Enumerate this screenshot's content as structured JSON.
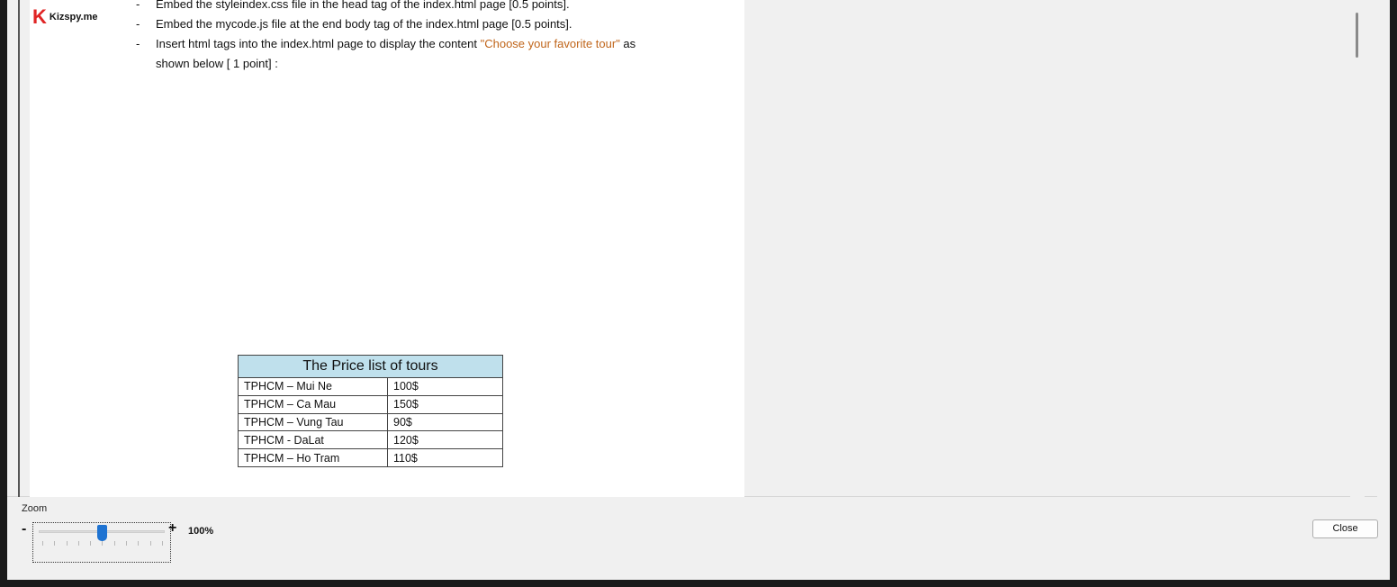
{
  "logo": {
    "mark": "K",
    "text": "Kizspy.me"
  },
  "document": {
    "bullets": [
      {
        "marker": "-",
        "text": "Embed the styleindex.css file in the head tag of the index.html page [0.5 points]."
      },
      {
        "marker": "-",
        "text": "Embed the mycode.js file at the end body tag of the index.html page [0.5 points]."
      },
      {
        "marker": "-",
        "text_before": "Insert html tags into the index.html page to display the content ",
        "highlight": "\"Choose your favorite tour\"",
        "text_after": " as",
        "continuation": "shown below [ 1 point] :"
      }
    ],
    "table": {
      "title": "The Price list of tours",
      "rows": [
        {
          "route": "TPHCM – Mui Ne",
          "price": "100$"
        },
        {
          "route": "TPHCM – Ca Mau",
          "price": "150$"
        },
        {
          "route": "TPHCM – Vung Tau",
          "price": "90$"
        },
        {
          "route": "TPHCM - DaLat",
          "price": "120$"
        },
        {
          "route": "TPHCM – Ho Tram",
          "price": "110$"
        }
      ]
    }
  },
  "zoom": {
    "label": "Zoom",
    "minus": "-",
    "plus": "+",
    "value": "100%",
    "slider_fraction": 0.5
  },
  "close_button": {
    "label": "Close"
  },
  "colors": {
    "highlight": "#c0651a",
    "table_header": "#bfe0ec",
    "slider_thumb": "#1e73d2",
    "logo_mark": "#e02424"
  }
}
